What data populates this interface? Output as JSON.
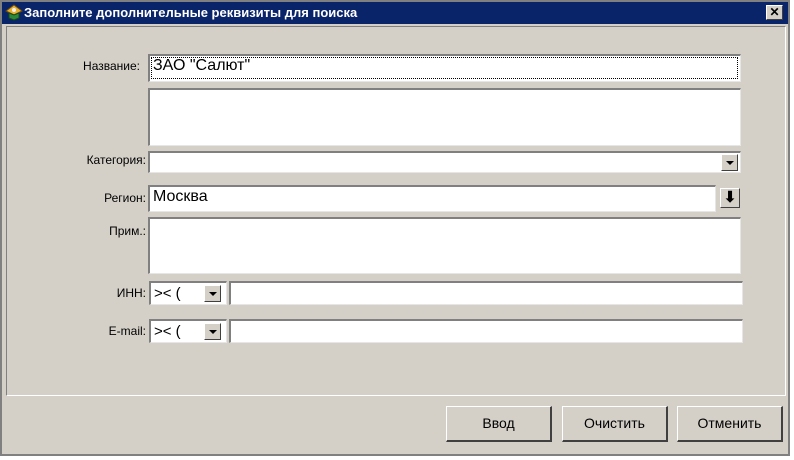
{
  "window": {
    "title": "Заполните дополнительные реквизиты для поиска",
    "close_label": "✕"
  },
  "form": {
    "name_label": "Название:",
    "name_value": "ЗАО \"Салют\"",
    "extra_value": "",
    "category_label": "Категория:",
    "category_value": "",
    "region_label": "Регион:",
    "region_value": "Москва",
    "region_pick_glyph": "⬇",
    "note_label": "Прим.:",
    "note_value": "",
    "inn_label": "ИНН:",
    "inn_operator": ">< (",
    "inn_value": "",
    "email_label": "E-mail:",
    "email_operator": ">< (",
    "email_value": ""
  },
  "buttons": {
    "ok": "Ввод",
    "clear": "Очистить",
    "cancel": "Отменить"
  },
  "colors": {
    "titlebar": "#0a246a",
    "window_bg": "#d4d0c8"
  }
}
